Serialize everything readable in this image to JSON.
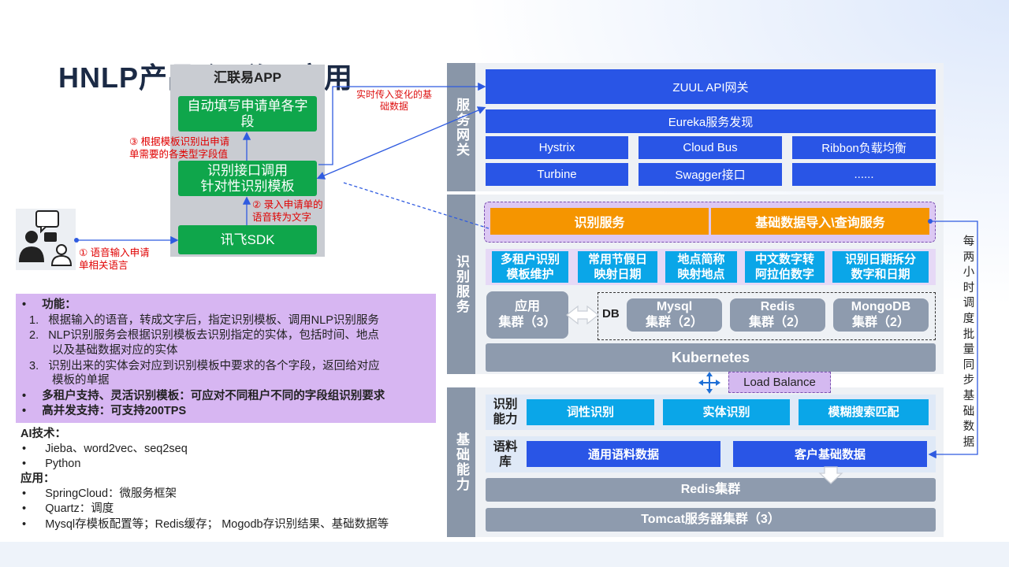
{
  "title": "HNLP产品-汇联易应用",
  "app": {
    "title": "汇联易APP",
    "auto_fill": "自动填写申请单各字段",
    "recognize_api": [
      "识别接口调用",
      "针对性识别模板"
    ],
    "xunfei": "讯飞SDK",
    "step3": [
      "③ 根据模板识别出申请",
      "单需要的各类型字段值"
    ],
    "step2": [
      "② 录入申请单的",
      "语音转为文字"
    ],
    "step1": [
      "① 语音输入申请",
      "单相关语言"
    ],
    "realtime_note": [
      "实时传入变化的基",
      "础数据"
    ]
  },
  "gateway": {
    "label": "服务网关",
    "zuul": "ZUUL API网关",
    "eureka": "Eureka服务发现",
    "row1": [
      "Hystrix",
      "Cloud Bus",
      "Ribbon负载均衡"
    ],
    "row2": [
      "Turbine",
      "Swagger接口",
      "......"
    ]
  },
  "recognition": {
    "label": "识别服务",
    "services": [
      "识别服务",
      "基础数据导入\\查询服务"
    ],
    "features": [
      [
        "多租户识别",
        "模板维护"
      ],
      [
        "常用节假日",
        "映射日期"
      ],
      [
        "地点简称",
        "映射地点"
      ],
      [
        "中文数字转",
        "阿拉伯数字"
      ],
      [
        "识别日期拆分",
        "数字和日期"
      ]
    ],
    "app_cluster": [
      "应用",
      "集群（3）"
    ],
    "db_label": "DB",
    "dbs": [
      [
        "Mysql",
        "集群（2）"
      ],
      [
        "Redis",
        "集群（2）"
      ],
      [
        "MongoDB",
        "集群（2）"
      ]
    ],
    "kubernetes": "Kubernetes",
    "load_balance": "Load Balance"
  },
  "basic": {
    "label": "基础能力",
    "ability_label": [
      "识别",
      "能力"
    ],
    "abilities": [
      "词性识别",
      "实体识别",
      "模糊搜索匹配"
    ],
    "corpus_label": [
      "语料",
      "库"
    ],
    "corpus": [
      "通用语料数据",
      "客户基础数据"
    ],
    "redis": "Redis集群",
    "tomcat": "Tomcat服务器集群（3）"
  },
  "sync_note": [
    "每",
    "两",
    "小",
    "时",
    "调",
    "度",
    "批",
    "量",
    "同",
    "步",
    "基",
    "础",
    "数",
    "据"
  ],
  "features_panel": {
    "heading": "功能：",
    "items": [
      "根据输入的语音，转成文字后，指定识别模板、调用NLP识别服务",
      "NLP识别服务会根据识别模板去识别指定的实体，包括时间、地点",
      "以及基础数据对应的实体",
      "识别出来的实体会对应到识别模板中要求的各个字段，返回给对应",
      "模板的单据"
    ],
    "bold_items": [
      "多租户支持、灵活识别模板：可应对不同租户不同的字段组识别要求",
      "高并发支持：可支持200TPS"
    ]
  },
  "tech": {
    "ai_heading": "AI技术：",
    "ai_items": [
      "Jieba、word2vec、seq2seq",
      "Python"
    ],
    "app_heading": "应用：",
    "app_items": [
      "SpringCloud：微服务框架",
      "Quartz：调度",
      "Mysql存模板配置等；Redis缓存； Mogodb存识别结果、基础数据等"
    ]
  },
  "colors": {
    "gateway_blue": "#2955e6",
    "cyan": "#0aa6e8",
    "orange": "#f59500",
    "green": "#0fa64b",
    "purple": "#d7b6f2",
    "gray": "#8e9bae"
  }
}
